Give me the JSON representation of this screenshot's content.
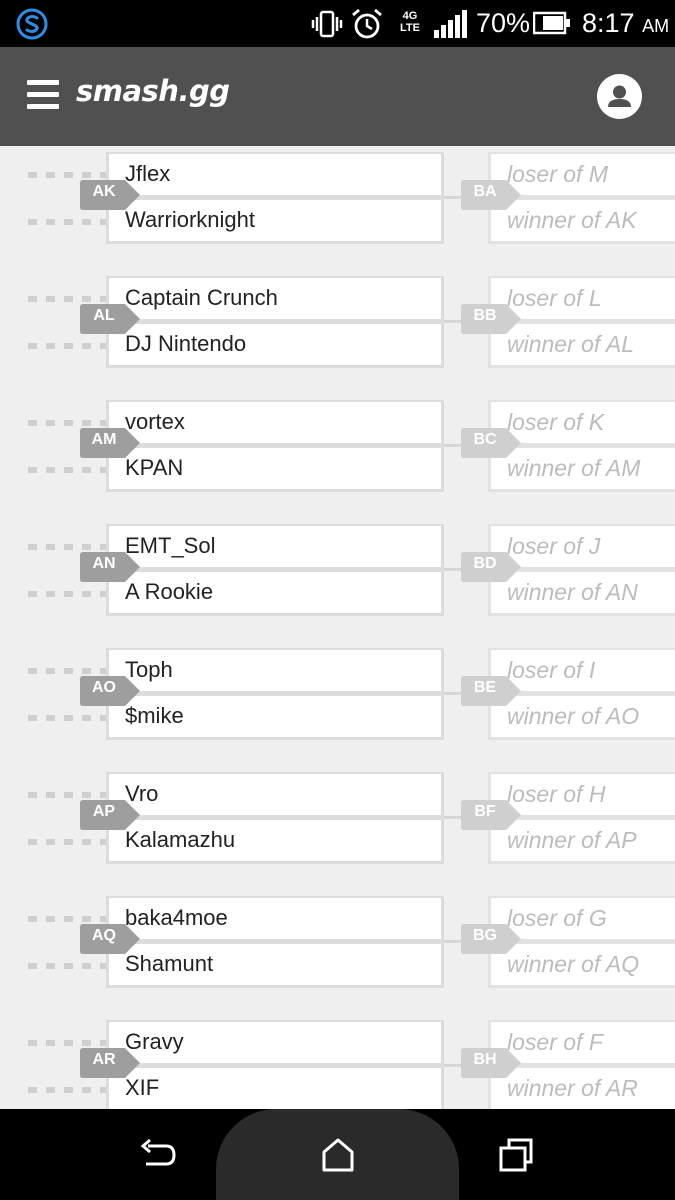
{
  "status_bar": {
    "battery_percent": "70%",
    "time": "8:17",
    "ampm": "AM",
    "network": "4G LTE"
  },
  "header": {
    "logo": "smash.gg"
  },
  "matches": [
    {
      "id": "AK",
      "player1": "Jflex",
      "player2": "Warriorknight",
      "next_id": "BA",
      "next_slot1": "loser of M",
      "next_slot2": "winner of AK"
    },
    {
      "id": "AL",
      "player1": "Captain Crunch",
      "player2": "DJ Nintendo",
      "next_id": "BB",
      "next_slot1": "loser of L",
      "next_slot2": "winner of AL"
    },
    {
      "id": "AM",
      "player1": "vortex",
      "player2": "KPAN",
      "next_id": "BC",
      "next_slot1": "loser of K",
      "next_slot2": "winner of AM"
    },
    {
      "id": "AN",
      "player1": "EMT_Sol",
      "player2": "A Rookie",
      "next_id": "BD",
      "next_slot1": "loser of J",
      "next_slot2": "winner of AN"
    },
    {
      "id": "AO",
      "player1": "Toph",
      "player2": "$mike",
      "next_id": "BE",
      "next_slot1": "loser of I",
      "next_slot2": "winner of AO"
    },
    {
      "id": "AP",
      "player1": "Vro",
      "player2": "Kalamazhu",
      "next_id": "BF",
      "next_slot1": "loser of H",
      "next_slot2": "winner of AP"
    },
    {
      "id": "AQ",
      "player1": "baka4moe",
      "player2": "Shamunt",
      "next_id": "BG",
      "next_slot1": "loser of G",
      "next_slot2": "winner of AQ"
    },
    {
      "id": "AR",
      "player1": "Gravy",
      "player2": "XIF",
      "next_id": "BH",
      "next_slot1": "loser of F",
      "next_slot2": "winner of AR"
    }
  ],
  "colors": {
    "header_bg": "#505050",
    "bracket_bg": "#efefef",
    "tag_active": "#9e9e9e",
    "tag_pending": "#cfcfcf",
    "app_icon": "#2f8de4"
  },
  "icons": {
    "status_app": "swiftkey-icon",
    "vibrate": "vibrate-icon",
    "alarm": "alarm-icon",
    "signal": "signal-icon",
    "battery": "battery-icon",
    "menu": "hamburger-menu-icon",
    "profile": "user-icon",
    "back": "back-icon",
    "home": "home-icon",
    "recents": "recents-icon"
  }
}
